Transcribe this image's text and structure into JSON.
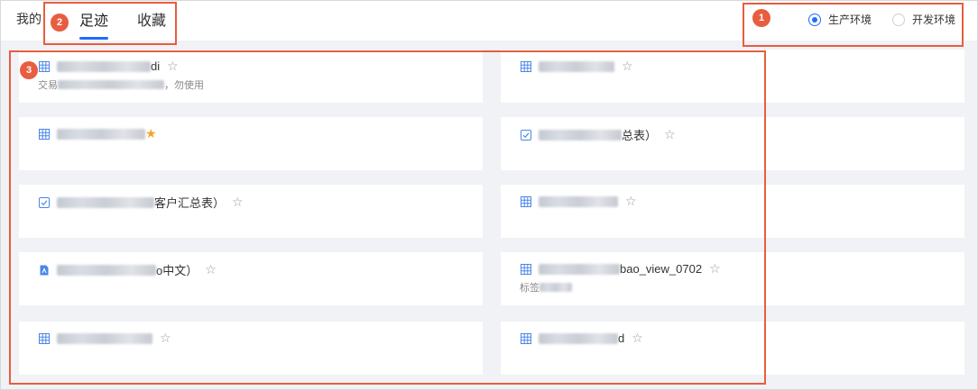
{
  "header": {
    "title": "我的",
    "tabs": [
      {
        "label": "足迹",
        "active": true
      },
      {
        "label": "收藏",
        "active": false
      }
    ],
    "environment": [
      {
        "label": "生产环境",
        "checked": true
      },
      {
        "label": "开发环境",
        "checked": false
      }
    ]
  },
  "annotations": [
    "1",
    "2",
    "3"
  ],
  "colors": {
    "accent": "#1f6bff",
    "annotation": "#e85d3f",
    "star_filled": "#f5a524"
  },
  "cards": [
    {
      "icon": "table-icon",
      "text": "di",
      "desc": "交易",
      "desc_tail": "，勿使用"
    },
    {
      "icon": "table-icon",
      "text": ""
    },
    {
      "icon": "table-icon",
      "text": "",
      "favorited": true
    },
    {
      "icon": "task-icon",
      "text": "总表）"
    },
    {
      "icon": "task-icon",
      "text": "客户汇总表）"
    },
    {
      "icon": "table-icon",
      "text": ""
    },
    {
      "icon": "document-icon",
      "text": "o中文）"
    },
    {
      "icon": "table-icon",
      "text": "bao_view_0702",
      "desc": "标签"
    },
    {
      "icon": "table-icon",
      "text": ""
    },
    {
      "icon": "table-icon",
      "text": "d"
    }
  ]
}
